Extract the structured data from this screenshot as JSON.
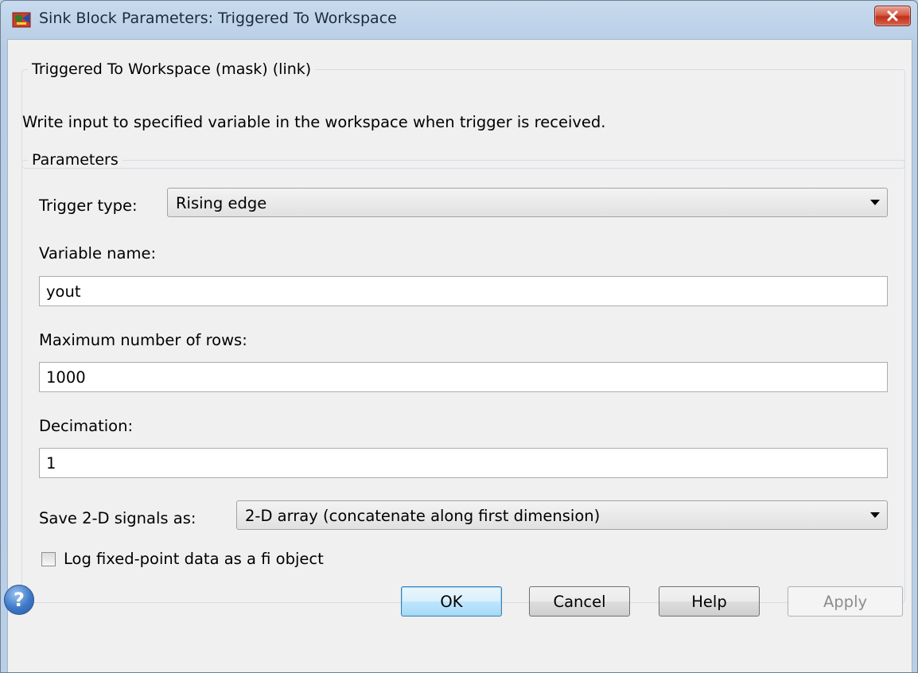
{
  "window": {
    "title": "Sink Block Parameters: Triggered To Workspace",
    "app_icon": "simulink-block-icon",
    "close_icon": "close-icon"
  },
  "description_group": {
    "legend": "Triggered To Workspace (mask) (link)",
    "text": "Write input to specified variable in the workspace when trigger is received."
  },
  "parameters": {
    "legend": "Parameters",
    "trigger_type": {
      "label": "Trigger type:",
      "value": "Rising edge"
    },
    "variable_name": {
      "label": "Variable name:",
      "value": "yout"
    },
    "max_rows": {
      "label": "Maximum number of rows:",
      "value": "1000"
    },
    "decimation": {
      "label": "Decimation:",
      "value": "1"
    },
    "save_2d": {
      "label": "Save 2-D signals as:",
      "value": "2-D array (concatenate along first dimension)"
    },
    "log_fixed_point": {
      "label": "Log fixed-point data as a fi object",
      "checked": false
    }
  },
  "buttons": {
    "help_icon": "?",
    "ok": "OK",
    "cancel": "Cancel",
    "help": "Help",
    "apply": "Apply"
  },
  "colors": {
    "title_bar": "#bcd1e6",
    "dialog_bg": "#f0f0f0",
    "close_button": "#c7432f",
    "default_button": "#bee6fd"
  }
}
